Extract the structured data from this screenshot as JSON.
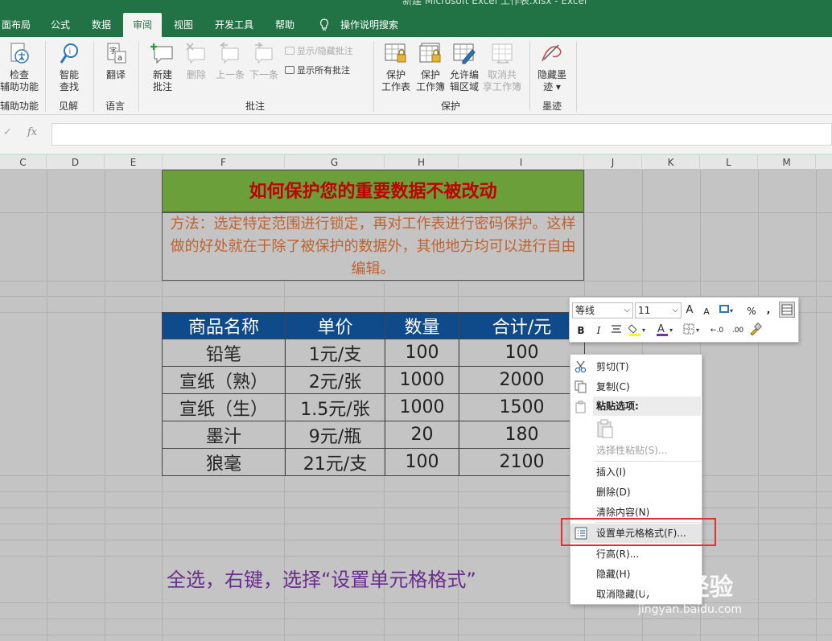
{
  "window": {
    "title": "新建 Microsoft Excel 工作表.xlsx  -  Excel"
  },
  "tabs": [
    "面布局",
    "公式",
    "数据",
    "审阅",
    "视图",
    "开发工具",
    "帮助",
    "操作说明搜索"
  ],
  "active_tab": "审阅",
  "ribbon": {
    "accessibility": {
      "line1": "检查",
      "line2": "辅助功能",
      "group": "辅助功能"
    },
    "insights": {
      "line1": "智能",
      "line2": "查找",
      "group": "见解"
    },
    "language": {
      "label": "翻译",
      "group": "语言"
    },
    "comments": {
      "new_line1": "新建",
      "new_line2": "批注",
      "delete": "删除",
      "previous": "上一条",
      "next": "下一条",
      "show_hide": "显示/隐藏批注",
      "show_all": "显示所有批注",
      "group": "批注"
    },
    "protect": {
      "sheet_line1": "保护",
      "sheet_line2": "工作表",
      "book_line1": "保护",
      "book_line2": "工作簿",
      "allow_line1": "允许编",
      "allow_line2": "辑区域",
      "unshare_line1": "取消共",
      "unshare_line2": "享工作簿",
      "group": "保护"
    },
    "ink": {
      "line1": "隐藏墨",
      "line2": "迹 ▾",
      "group": "墨迹"
    }
  },
  "formula_bar": {
    "fx": "fx",
    "value": ""
  },
  "columns": [
    "C",
    "D",
    "E",
    "F",
    "G",
    "H",
    "I",
    "J",
    "K",
    "L",
    "M"
  ],
  "sheet": {
    "title": "如何保护您的重要数据不被改动",
    "description": "方法：选定特定范围进行锁定，再对工作表进行密码保护。这样做的好处就在于除了被保护的数据外，其他地方均可以进行自由编辑。",
    "table": {
      "headers": [
        "商品名称",
        "单价",
        "数量",
        "合计/元"
      ],
      "rows": [
        [
          "铅笔",
          "1元/支",
          "100",
          "100"
        ],
        [
          "宣纸（熟）",
          "2元/张",
          "1000",
          "2000"
        ],
        [
          "宣纸（生）",
          "1.5元/张",
          "1000",
          "1500"
        ],
        [
          "墨汁",
          "9元/瓶",
          "20",
          "180"
        ],
        [
          "狼毫",
          "21元/支",
          "100",
          "2100"
        ]
      ]
    },
    "note": "全选，右键，选择“设置单元格格式”"
  },
  "mini_toolbar": {
    "font": "等线",
    "size": "11",
    "grow": "A",
    "shrink": "A",
    "percent": "%",
    "comma": ",",
    "bold": "B",
    "italic": "I",
    "font_color": "A",
    "dec_inc": "←.0",
    "dec_dec": ".00"
  },
  "context_menu": {
    "cut": "剪切(T)",
    "copy": "复制(C)",
    "paste_options": "粘贴选项:",
    "paste_special": "选择性粘贴(S)...",
    "insert": "插入(I)",
    "delete": "删除(D)",
    "clear": "清除内容(N)",
    "format_cells": "设置单元格格式(F)...",
    "row_height": "行高(R)...",
    "hide": "隐藏(H)",
    "unhide": "取消隐藏(U)"
  },
  "watermark": {
    "brand": "Bai经验",
    "url": "jingyan.baidu.com"
  },
  "colors": {
    "excel_green": "#217346",
    "title_fill": "#6a9f3a",
    "header_fill": "#0f4a8b",
    "highlight": "#e03030"
  }
}
